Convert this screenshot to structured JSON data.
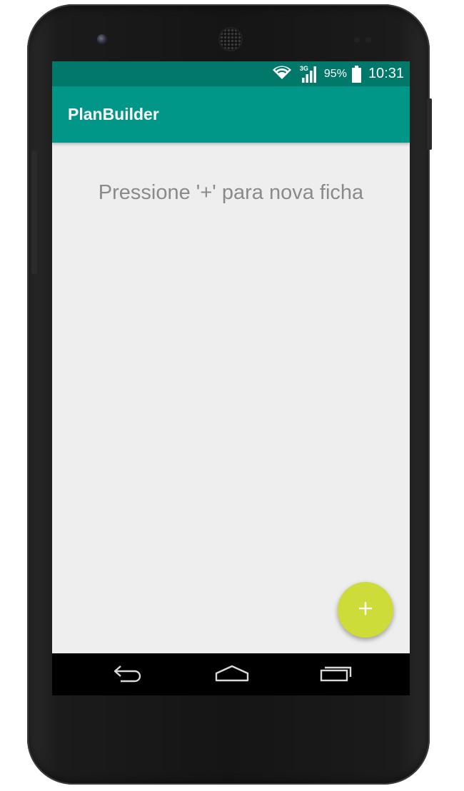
{
  "status_bar": {
    "network_type": "3G",
    "battery_percent": "95%",
    "time": "10:31",
    "icons": [
      "wifi-icon",
      "cell-signal-icon",
      "battery-icon"
    ]
  },
  "app_bar": {
    "title": "PlanBuilder"
  },
  "main": {
    "empty_message": "Pressione '+' para nova ficha"
  },
  "fab": {
    "icon": "plus-icon"
  },
  "nav_bar": {
    "icons": [
      "back-icon",
      "home-icon",
      "recent-apps-icon"
    ]
  },
  "colors": {
    "status_bar": "#00796b",
    "app_bar": "#009688",
    "background": "#eeeeee",
    "fab": "#cddc39",
    "hint_text": "#8a8a8a"
  }
}
